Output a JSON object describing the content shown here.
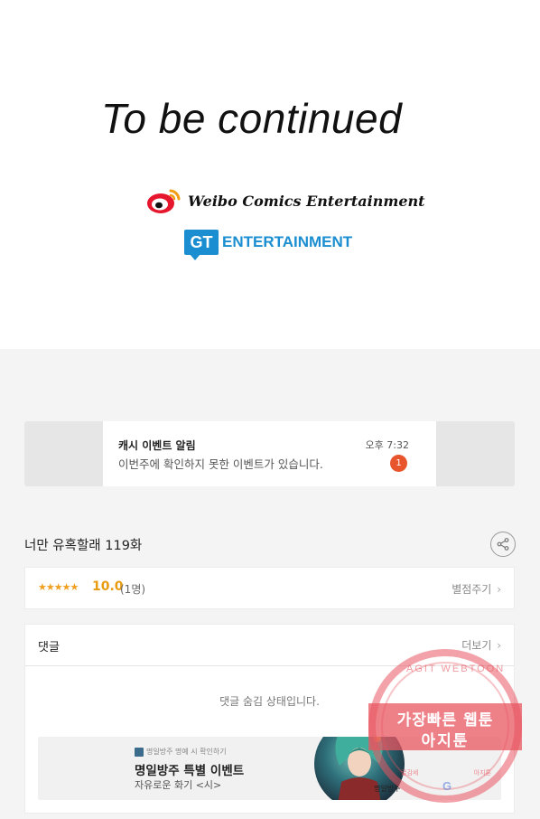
{
  "comic_end": {
    "to_be_continued": "To be continued",
    "weibo_text": "Weibo Comics Entertainment",
    "gt_badge": "GT",
    "gt_text": "ENTERTAINMENT"
  },
  "notice": {
    "title": "캐시 이벤트 알림",
    "time": "오후 7:32",
    "body": "이번주에 확인하지 못한 이벤트가 있습니다.",
    "badge_count": "1"
  },
  "episode": {
    "title": "너만 유혹할래 119화"
  },
  "rating": {
    "stars": "★★★★★",
    "score": "10.0",
    "count": "(1명)",
    "rate_label": "별점주기"
  },
  "comments": {
    "title": "댓글",
    "more_label": "더보기",
    "hidden_message": "댓글 숨김 상태입니다."
  },
  "ad": {
    "small_text": "명일방주 명예 시 확인하기",
    "title": "명일방주 특별 이벤트",
    "subtitle": "자유로운 화기 <시>",
    "image_caption": "명일방주"
  },
  "watermark": {
    "arc_text": "AGIT WEBTOON",
    "line1": "가장빠른 웹툰",
    "line2": "아지툰",
    "bottom_left": "글감세",
    "bottom_right": "아지툰",
    "g_letter": "G"
  },
  "colors": {
    "accent_orange": "#e89a10",
    "badge_red": "#e8542b",
    "gt_blue": "#1a8ed0",
    "watermark_red": "#e85660"
  }
}
